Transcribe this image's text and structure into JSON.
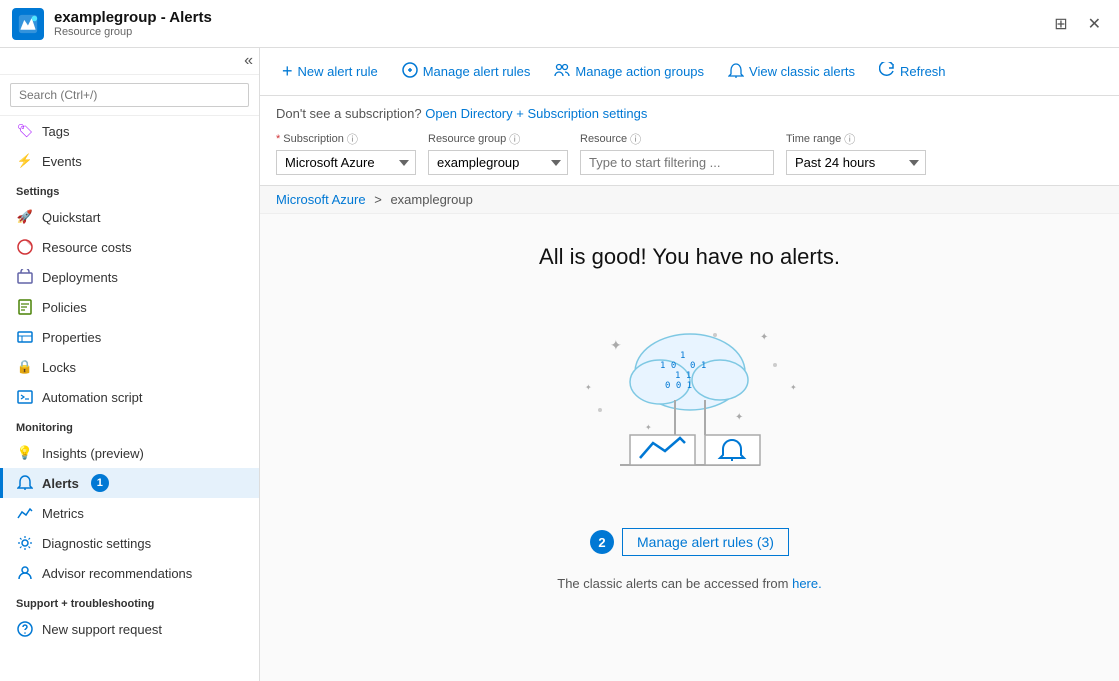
{
  "titleBar": {
    "appName": "examplegroup - Alerts",
    "subtitle": "Resource group",
    "pinIcon": "📌",
    "closeIcon": "✕"
  },
  "sidebar": {
    "searchPlaceholder": "Search (Ctrl+/)",
    "collapseIcon": "«",
    "items": [
      {
        "id": "tags",
        "label": "Tags",
        "icon": "tag",
        "color": "#a100ff",
        "section": null
      },
      {
        "id": "events",
        "label": "Events",
        "icon": "lightning",
        "color": "#ffb900",
        "section": null
      },
      {
        "id": "settings-label",
        "label": "Settings",
        "type": "section"
      },
      {
        "id": "quickstart",
        "label": "Quickstart",
        "icon": "rocket",
        "color": "#0078d4"
      },
      {
        "id": "resource-costs",
        "label": "Resource costs",
        "icon": "chart-donut",
        "color": "#d13438"
      },
      {
        "id": "deployments",
        "label": "Deployments",
        "icon": "deployments",
        "color": "#6264a7"
      },
      {
        "id": "policies",
        "label": "Policies",
        "icon": "policies",
        "color": "#498205"
      },
      {
        "id": "properties",
        "label": "Properties",
        "icon": "properties",
        "color": "#0078d4"
      },
      {
        "id": "locks",
        "label": "Locks",
        "icon": "lock",
        "color": "#333"
      },
      {
        "id": "automation-script",
        "label": "Automation script",
        "icon": "script",
        "color": "#0078d4"
      },
      {
        "id": "monitoring-label",
        "label": "Monitoring",
        "type": "section"
      },
      {
        "id": "insights",
        "label": "Insights (preview)",
        "icon": "bulb",
        "color": "#ffb900"
      },
      {
        "id": "alerts",
        "label": "Alerts",
        "icon": "bell",
        "color": "#0078d4",
        "active": true,
        "badge": "1"
      },
      {
        "id": "metrics",
        "label": "Metrics",
        "icon": "bar-chart",
        "color": "#0078d4"
      },
      {
        "id": "diagnostic-settings",
        "label": "Diagnostic settings",
        "icon": "settings-gear",
        "color": "#0078d4"
      },
      {
        "id": "advisor-recommendations",
        "label": "Advisor recommendations",
        "icon": "advisor",
        "color": "#0078d4"
      },
      {
        "id": "support-label",
        "label": "Support + troubleshooting",
        "type": "section"
      },
      {
        "id": "new-support-request",
        "label": "New support request",
        "icon": "support",
        "color": "#0078d4"
      }
    ]
  },
  "toolbar": {
    "newAlertRule": "New alert rule",
    "manageAlertRules": "Manage alert rules",
    "manageActionGroups": "Manage action groups",
    "viewClassicAlerts": "View classic alerts",
    "refresh": "Refresh"
  },
  "filterBar": {
    "noticeText": "Don't see a subscription?",
    "noticeLink": "Open Directory + Subscription settings",
    "subscriptionLabel": "Subscription",
    "subscriptionValue": "Microsoft Azure",
    "resourceGroupLabel": "Resource group",
    "resourceGroupValue": "examplegroup",
    "resourceLabel": "Resource",
    "resourcePlaceholder": "Type to start filtering ...",
    "timeRangeLabel": "Time range",
    "timeRangeValue": "Past 24 hours"
  },
  "breadcrumb": {
    "root": "Microsoft Azure",
    "separator": ">",
    "current": "examplegroup"
  },
  "mainContent": {
    "noAlertsTitle": "All is good! You have no alerts.",
    "manageAlertRulesLink": "Manage alert rules (3)",
    "badgeNumber": "2",
    "classicNotice": "The classic alerts can be accessed from",
    "classicLink": "here."
  }
}
